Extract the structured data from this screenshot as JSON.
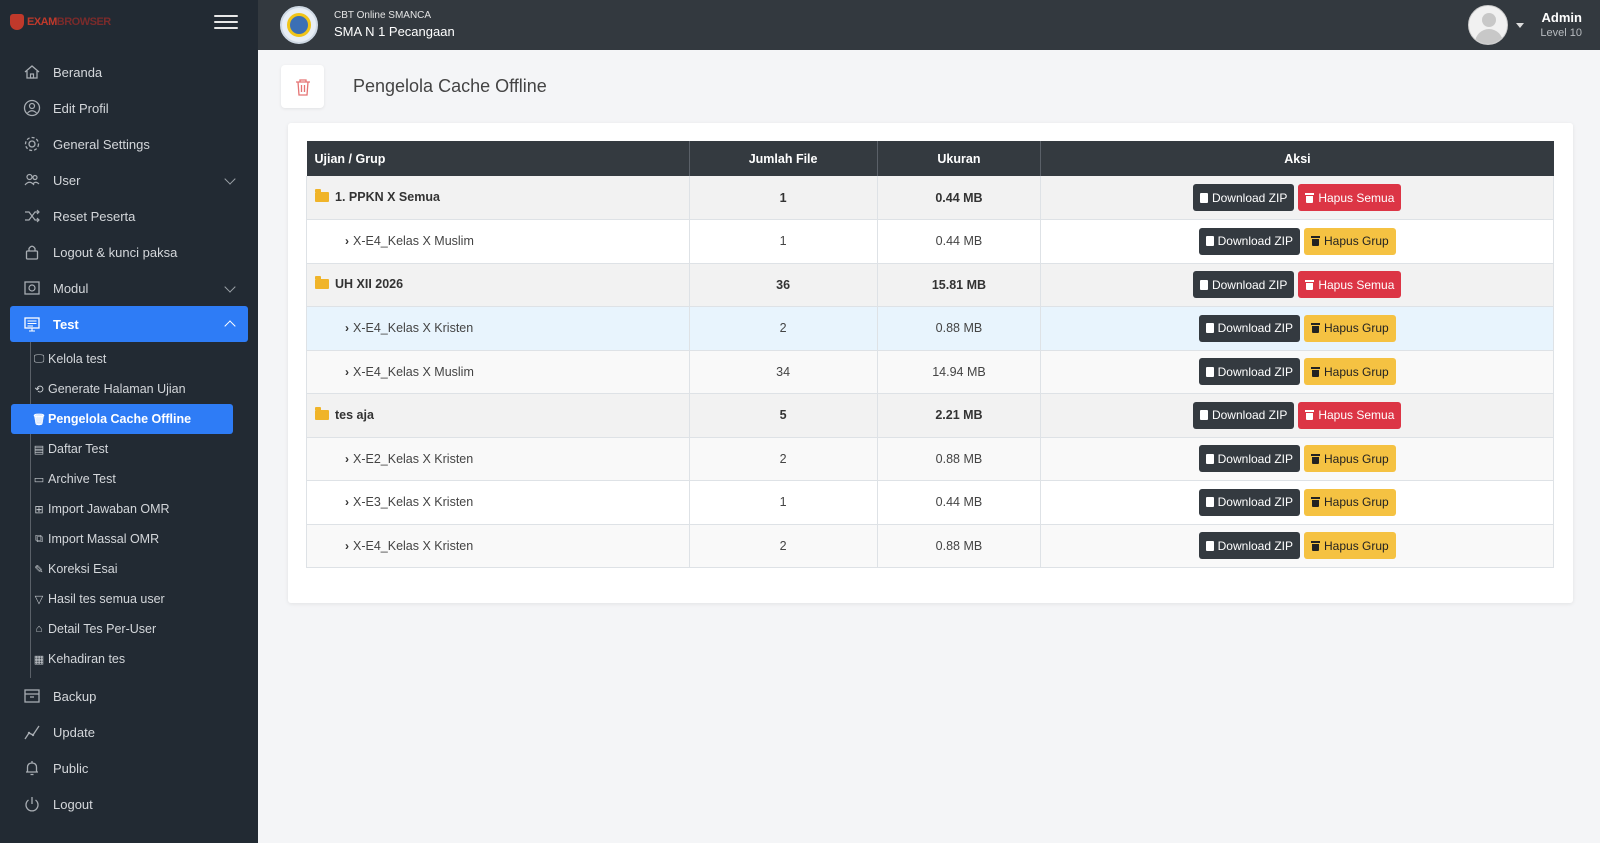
{
  "brand": {
    "logo_text_a": "EXAM",
    "logo_text_b": "BROWSER"
  },
  "sidebar": {
    "items": [
      {
        "label": "Beranda",
        "icon": "home-icon"
      },
      {
        "label": "Edit Profil",
        "icon": "user-circle-icon"
      },
      {
        "label": "General Settings",
        "icon": "gear-icon"
      },
      {
        "label": "User",
        "icon": "users-icon"
      },
      {
        "label": "Reset Peserta",
        "icon": "shuffle-icon"
      },
      {
        "label": "Logout & kunci paksa",
        "icon": "lock-icon"
      },
      {
        "label": "Modul",
        "icon": "module-icon"
      },
      {
        "label": "Test",
        "icon": "monitor-icon"
      }
    ],
    "test_sub": [
      {
        "label": "Kelola test"
      },
      {
        "label": "Generate Halaman Ujian"
      },
      {
        "label": "Pengelola Cache Offline"
      },
      {
        "label": "Daftar Test"
      },
      {
        "label": "Archive Test"
      },
      {
        "label": "Import Jawaban OMR"
      },
      {
        "label": "Import Massal OMR"
      },
      {
        "label": "Koreksi Esai"
      },
      {
        "label": "Hasil tes semua user"
      },
      {
        "label": "Detail Tes Per-User"
      },
      {
        "label": "Kehadiran tes"
      }
    ],
    "bottom_items": [
      {
        "label": "Backup",
        "icon": "backup-icon"
      },
      {
        "label": "Update",
        "icon": "chart-line-icon"
      },
      {
        "label": "Public",
        "icon": "bell-icon"
      },
      {
        "label": "Logout",
        "icon": "power-icon"
      }
    ]
  },
  "topbar": {
    "app_name": "CBT Online SMANCA",
    "school_name": "SMA N 1 Pecangaan",
    "user_name": "Admin",
    "user_level": "Level 10"
  },
  "page": {
    "title": "Pengelola Cache Offline"
  },
  "table": {
    "headers": [
      "Ujian / Grup",
      "Jumlah File",
      "Ukuran",
      "Aksi"
    ],
    "rows": [
      {
        "type": "group",
        "name": "1. PPKN X Semua",
        "files": "1",
        "size": "0.44 MB"
      },
      {
        "type": "child",
        "name": "X-E4_Kelas X Muslim",
        "files": "1",
        "size": "0.44 MB"
      },
      {
        "type": "group",
        "name": "UH XII 2026",
        "files": "36",
        "size": "15.81 MB"
      },
      {
        "type": "child",
        "name": "X-E4_Kelas X Kristen",
        "files": "2",
        "size": "0.88 MB"
      },
      {
        "type": "child",
        "name": "X-E4_Kelas X Muslim",
        "files": "34",
        "size": "14.94 MB"
      },
      {
        "type": "group",
        "name": "tes aja",
        "files": "5",
        "size": "2.21 MB"
      },
      {
        "type": "child",
        "name": "X-E2_Kelas X Kristen",
        "files": "2",
        "size": "0.88 MB"
      },
      {
        "type": "child",
        "name": "X-E3_Kelas X Kristen",
        "files": "1",
        "size": "0.44 MB"
      },
      {
        "type": "child",
        "name": "X-E4_Kelas X Kristen",
        "files": "2",
        "size": "0.88 MB"
      }
    ]
  },
  "actions": {
    "download_label": "Download ZIP",
    "hapus_semua_label": "Hapus Semua",
    "hapus_grup_label": "Hapus Grup"
  },
  "colors": {
    "sidebar_bg": "#222a33",
    "topbar_bg": "#33393f",
    "active_blue": "#2e7cf6",
    "danger": "#dc3545",
    "warning": "#f5c242",
    "dark": "#343a40"
  }
}
